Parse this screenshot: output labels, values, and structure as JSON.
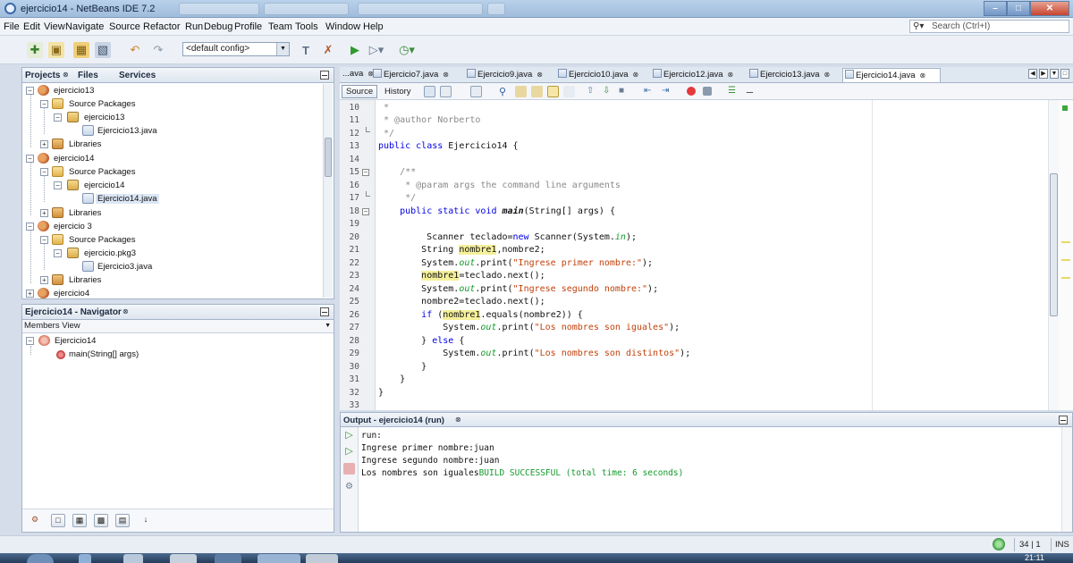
{
  "window": {
    "title": "ejercicio14 - NetBeans IDE 7.2"
  },
  "menu": [
    "File",
    "Edit",
    "View",
    "Navigate",
    "Source",
    "Refactor",
    "Run",
    "Debug",
    "Profile",
    "Team",
    "Tools",
    "Window",
    "Help"
  ],
  "search": {
    "placeholder": "Search (Ctrl+I)"
  },
  "toolbar": {
    "config": "<default config>"
  },
  "projects_panel": {
    "tabs": [
      "Projects",
      "Files",
      "Services"
    ],
    "tree": [
      {
        "label": "ejercicio13"
      },
      {
        "label": "Source Packages"
      },
      {
        "label": "ejercicio13"
      },
      {
        "label": "Ejercicio13.java"
      },
      {
        "label": "Libraries"
      },
      {
        "label": "ejercicio14"
      },
      {
        "label": "Source Packages"
      },
      {
        "label": "ejercicio14"
      },
      {
        "label": "Ejercicio14.java"
      },
      {
        "label": "Libraries"
      },
      {
        "label": "ejercicio 3"
      },
      {
        "label": "Source Packages"
      },
      {
        "label": "ejercicio.pkg3"
      },
      {
        "label": "Ejercicio3.java"
      },
      {
        "label": "Libraries"
      },
      {
        "label": "ejercicio4"
      }
    ]
  },
  "navigator": {
    "title": "Ejercicio14 - Navigator",
    "view": "Members View",
    "tree": [
      {
        "label": "Ejercicio14"
      },
      {
        "label": "main(String[] args)"
      }
    ]
  },
  "editor": {
    "tabs": [
      {
        "label": "...ava"
      },
      {
        "label": "Ejercicio7.java"
      },
      {
        "label": "Ejercicio9.java"
      },
      {
        "label": "Ejercicio10.java"
      },
      {
        "label": "Ejercicio12.java"
      },
      {
        "label": "Ejercicio13.java"
      },
      {
        "label": "Ejercicio14.java"
      }
    ],
    "active_tab": "Ejercicio14.java",
    "source_label": "Source",
    "history_label": "History",
    "line_numbers": [
      "10",
      "11",
      "12",
      "13",
      "14",
      "15",
      "16",
      "17",
      "18",
      "19",
      "20",
      "21",
      "22",
      "23",
      "24",
      "25",
      "26",
      "27",
      "28",
      "29",
      "30",
      "31",
      "32",
      "33"
    ],
    "code": [
      " *",
      " * @author Norberto",
      " */",
      "public class Ejercicio14 {",
      "",
      "    /**",
      "     * @param args the command line arguments",
      "     */",
      "    public static void main(String[] args) {",
      "",
      "         Scanner teclado=new Scanner(System.in);",
      "        String nombre1,nombre2;",
      "        System.out.print(\"Ingrese primer nombre:\");",
      "        nombre1=teclado.next();",
      "        System.out.print(\"Ingrese segundo nombre:\");",
      "        nombre2=teclado.next();",
      "        if (nombre1.equals(nombre2)) {",
      "            System.out.print(\"Los nombres son iguales\");",
      "        } else {",
      "            System.out.print(\"Los nombres son distintos\");",
      "        }",
      "    }",
      "}",
      ""
    ]
  },
  "output": {
    "title": "Output - ejercicio14 (run)",
    "lines": [
      "run:",
      "Ingrese primer nombre:juan",
      "Ingrese segundo nombre:juan"
    ],
    "last_line_text": "Los nombres son iguales",
    "last_line_status": "BUILD SUCCESSFUL (total time: 6 seconds)"
  },
  "status": {
    "position": "34 | 1",
    "mode": "INS"
  },
  "taskbar": {
    "clock": "21:11"
  },
  "colors": {
    "keyword": "#0000e6",
    "string": "#c2410c",
    "comment": "#8a8a8a",
    "field": "#139a2c",
    "highlight": "#f5f09a"
  }
}
